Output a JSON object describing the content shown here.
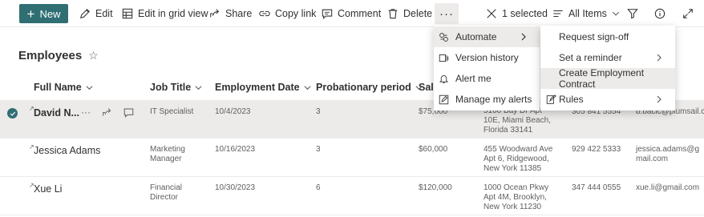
{
  "toolbar": {
    "new_label": "New",
    "edit_label": "Edit",
    "grid_label": "Edit in grid view",
    "share_label": "Share",
    "copy_link_label": "Copy link",
    "comment_label": "Comment",
    "delete_label": "Delete",
    "more_label": "···",
    "selected_label": "1 selected",
    "view_label": "All Items"
  },
  "list": {
    "title": "Employees",
    "star": "☆",
    "columns": [
      "Full Name",
      "Job Title",
      "Employment Date",
      "Probationary period",
      "Sala"
    ],
    "rows": [
      {
        "full_name": "David N...",
        "job_title": "IT Specialist",
        "employment_date": "10/4/2023",
        "probation": "3",
        "salary": "$75,000",
        "address": "5100 Bay Dr Apt 10E, Miami Beach, Florida 33141",
        "phone": "305 841 5554",
        "email": "b.bacic@plumsail.com"
      },
      {
        "full_name": "Jessica Adams",
        "job_title": "Marketing Manager",
        "employment_date": "10/16/2023",
        "probation": "3",
        "salary": "$60,000",
        "address": "455 Woodward Ave Apt 6, Ridgewood, New York 11385",
        "phone": "929 422 5333",
        "email": "jessica.adams@gmail.com"
      },
      {
        "full_name": "Xue Li",
        "job_title": "Financial Director",
        "employment_date": "10/30/2023",
        "probation": "6",
        "salary": "$120,000",
        "address": "1000 Ocean Pkwy Apt 4M, Brooklyn, New York 11230",
        "phone": "347 444 0555",
        "email": "xue.li@gmail.com"
      }
    ]
  },
  "more_menu": {
    "items": [
      "Automate",
      "Version history",
      "Alert me",
      "Manage my alerts"
    ]
  },
  "automate_menu": {
    "items": [
      "Request sign-off",
      "Set a reminder",
      "Create Employment Contract",
      "Rules"
    ]
  },
  "colors": {
    "accent": "#2f6f73",
    "selected_row": "#edebe9",
    "text": "#323130",
    "secondary_text": "#605e5c"
  }
}
